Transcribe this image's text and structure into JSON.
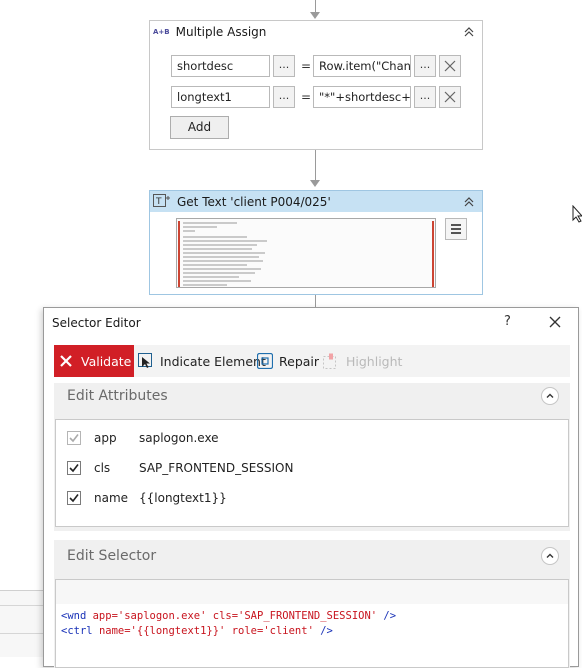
{
  "multiple_assign": {
    "title": "Multiple Assign",
    "icon_text": "A+B",
    "rows": [
      {
        "target": "shortdesc",
        "dots": "...",
        "equals": "=",
        "value": "Row.item(\"Chan",
        "value_dots": "..."
      },
      {
        "target": "longtext1",
        "dots": "...",
        "equals": "=",
        "value": "\"*\"+shortdesc+\"",
        "value_dots": "..."
      }
    ],
    "add_label": "Add"
  },
  "get_text": {
    "title": "Get Text 'client P004/025'",
    "icon_text": "T"
  },
  "selector_editor": {
    "title": "Selector Editor",
    "help": "?",
    "toolbar": {
      "validate": "Validate",
      "indicate": "Indicate Element",
      "repair": "Repair",
      "highlight": "Highlight"
    },
    "edit_attributes": {
      "title": "Edit Attributes",
      "rows": [
        {
          "name": "app",
          "value": "saplogon.exe",
          "checked": true,
          "disabled": true
        },
        {
          "name": "cls",
          "value": "SAP_FRONTEND_SESSION",
          "checked": true,
          "disabled": false
        },
        {
          "name": "name",
          "value": "{{longtext1}}",
          "checked": true,
          "disabled": false
        }
      ]
    },
    "edit_selector": {
      "title": "Edit Selector",
      "line1": {
        "open": "<wnd ",
        "a1": "app=",
        "v1": "'saplogon.exe'",
        "a2": " cls=",
        "v2": "'SAP_FRONTEND_SESSION'",
        "close": " />"
      },
      "line2": {
        "open": "<ctrl ",
        "a1": "name=",
        "v1": "'{{longtext1}}'",
        "a2": " role=",
        "v2": "'client'",
        "close": " />"
      }
    }
  },
  "colors": {
    "accent_red": "#d11f26",
    "activity_header_blue": "#c6e1f3",
    "selector_keyword": "#1a33b8",
    "selector_attr": "#c8141e"
  }
}
